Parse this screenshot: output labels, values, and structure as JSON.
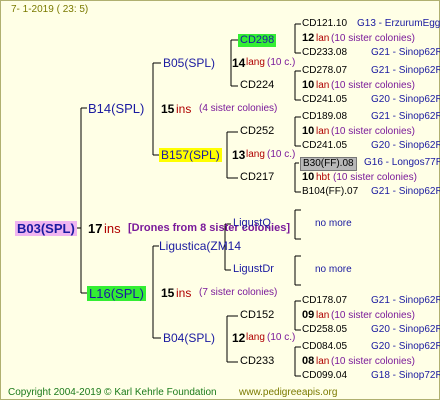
{
  "header": {
    "date": "7-  1-2019 ( 23:  5)"
  },
  "footer": {
    "copyright": "Copyright 2004-2019 © Karl Kehrle Foundation",
    "site": "www.pedigreeapis.org"
  },
  "root": {
    "label": "B03(SPL)",
    "ins_num": "17",
    "ins": "ins",
    "note": "[Drones from 8 sister colonies]"
  },
  "gen1": {
    "b14": {
      "label": "B14(SPL)",
      "ins_num": "15",
      "ins": "ins",
      "note": "(4 sister colonies)"
    },
    "l16": {
      "label": "L16(SPL)",
      "ins_num": "15",
      "ins": "ins",
      "note": "(7 sister colonies)"
    }
  },
  "gen2": {
    "b05": {
      "label": "B05(SPL)",
      "n": "14",
      "lang": "lang",
      "c": "(10 c.)"
    },
    "b157": {
      "label": "B157(SPL)",
      "n": "13",
      "lang": "lang",
      "c": "(10 c.)"
    },
    "ligustica": {
      "label": "Ligustica(ZM14"
    },
    "b04": {
      "label": "B04(SPL)",
      "n": "12",
      "lang": "lang",
      "c": "(10 c.)"
    }
  },
  "gen3": {
    "cd298": "CD298",
    "cd224": "CD224",
    "cd252": "CD252",
    "cd217": "CD217",
    "ligustq": "LigustQ",
    "ligustdr": "LigustDr",
    "cd152": "CD152",
    "cd233": "CD233",
    "no_more_1": "no more",
    "no_more_2": "no more"
  },
  "gen4": [
    {
      "label": "CD121.10",
      "ref": "G13 - ErzurumEgg8",
      "mid": {
        "n": "12",
        "kind": "lan",
        "note": "(10 sister colonies)"
      }
    },
    {
      "label": "CD233.08",
      "ref": "G21 - Sinop62R"
    },
    {
      "label": "CD278.07",
      "ref": "G21 - Sinop62R",
      "mid": {
        "n": "10",
        "kind": "lan",
        "note": "(10 sister colonies)"
      }
    },
    {
      "label": "CD241.05",
      "ref": "G20 - Sinop62R"
    },
    {
      "label": "CD189.08",
      "ref": "G21 - Sinop62R",
      "mid": {
        "n": "10",
        "kind": "lan",
        "note": "(10 sister colonies)"
      }
    },
    {
      "label": "CD241.05",
      "ref": "G20 - Sinop62R"
    },
    {
      "label": "B30(FF).08",
      "ref": "G16 - Longos77R",
      "mid": {
        "n": "10",
        "kind": "hbt",
        "note": "(10 sister colonies)"
      }
    },
    {
      "label": "B104(FF).07",
      "ref": "G21 - Sinop62R"
    },
    {
      "label": "CD178.07",
      "ref": "G21 - Sinop62R",
      "mid": {
        "n": "09",
        "kind": "lan",
        "note": "(10 sister colonies)"
      }
    },
    {
      "label": "CD258.05",
      "ref": "G20 - Sinop62R"
    },
    {
      "label": "CD084.05",
      "ref": "G20 - Sinop62R",
      "mid": {
        "n": "08",
        "kind": "lan",
        "note": "(10 sister colonies)"
      }
    },
    {
      "label": "CD099.04",
      "ref": "G18 - Sinop72R"
    }
  ],
  "colors": {
    "background": "#ffffe6",
    "root_highlight": "#f0b4f0",
    "green_highlight": "#33ee33",
    "yellow_highlight": "#ffff00",
    "gray_highlight": "#b8b8b8"
  }
}
